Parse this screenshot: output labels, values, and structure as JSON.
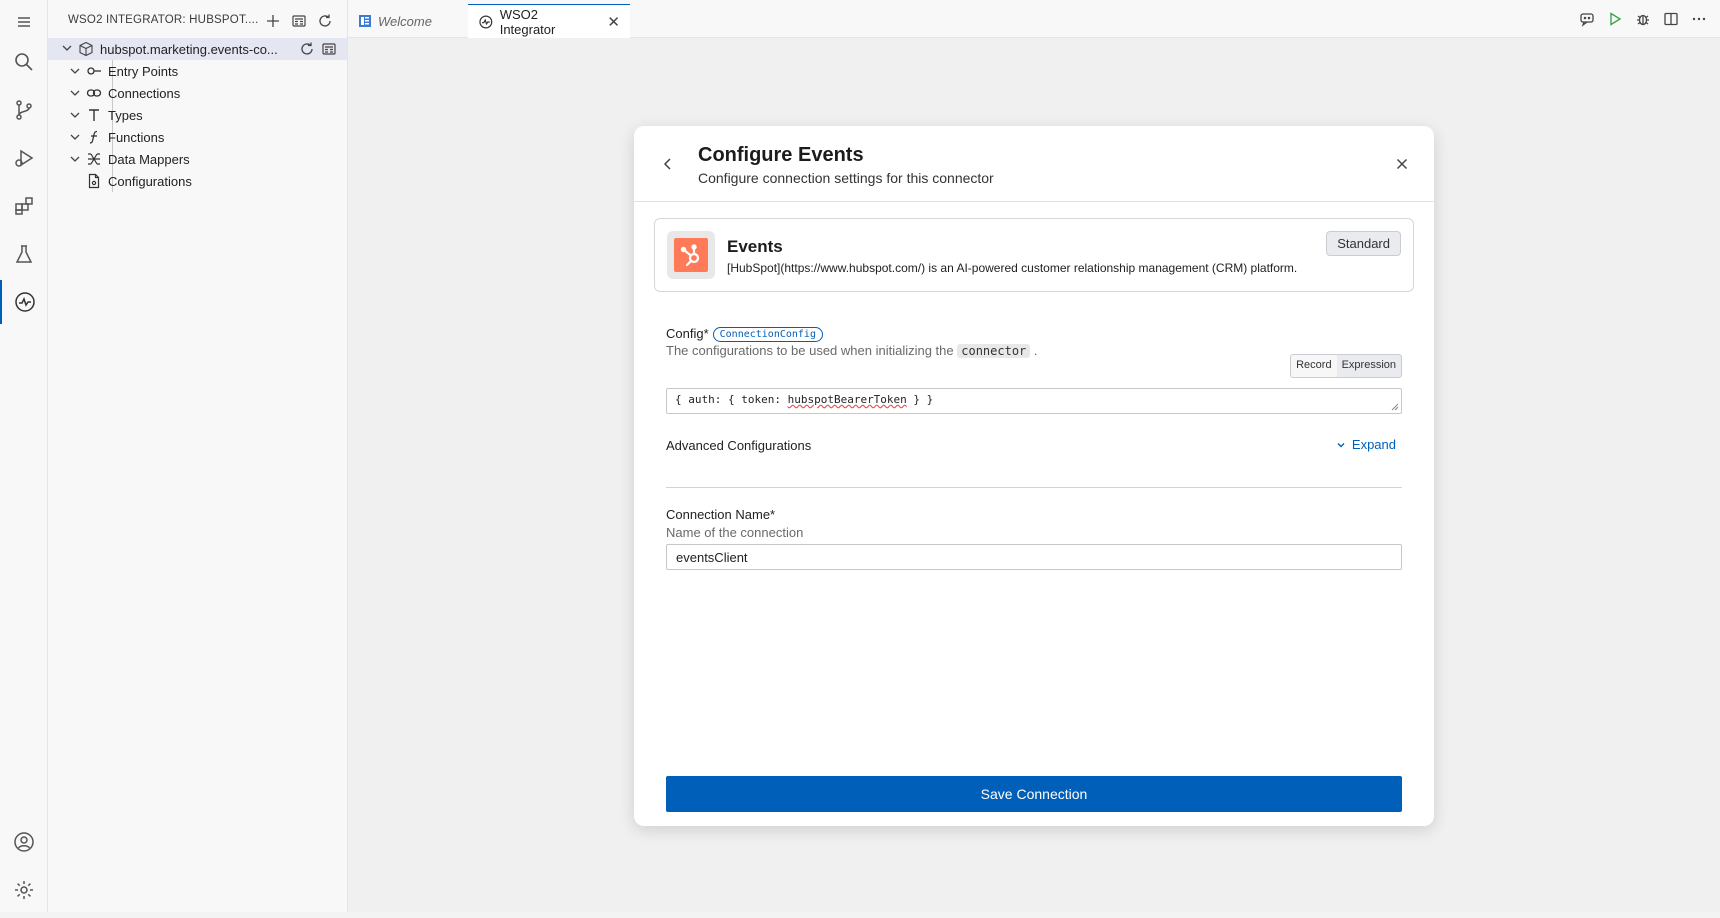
{
  "sidebar": {
    "title": "WSO2 INTEGRATOR: HUBSPOT....",
    "root": "hubspot.marketing.events-co...",
    "items": [
      {
        "label": "Entry Points",
        "icon": "entry-points-icon"
      },
      {
        "label": "Connections",
        "icon": "link-icon"
      },
      {
        "label": "Types",
        "icon": "type-icon"
      },
      {
        "label": "Functions",
        "icon": "function-icon"
      },
      {
        "label": "Data Mappers",
        "icon": "data-mapper-icon"
      },
      {
        "label": "Configurations",
        "icon": "config-file-icon"
      }
    ]
  },
  "tabs": {
    "welcome": "Welcome",
    "active": "WSO2 Integrator"
  },
  "modal": {
    "title": "Configure Events",
    "subtitle": "Configure connection settings for this connector",
    "connector": {
      "name": "Events",
      "description": "[HubSpot](https://www.hubspot.com/) is an AI-powered customer relationship management (CRM) platform.",
      "badge": "Standard",
      "brand_color": "#ff7a59"
    },
    "config": {
      "label": "Config*",
      "type_chip": "ConnectionConfig",
      "description_prefix": "The configurations to be used when initializing the",
      "description_code": "connector",
      "description_suffix": ".",
      "mode_record": "Record",
      "mode_expression": "Expression",
      "value_prefix": "{ auth: { token: ",
      "value_token": "hubspotBearerToken",
      "value_suffix": " } }"
    },
    "advanced": {
      "label": "Advanced Configurations",
      "toggle": "Expand"
    },
    "connection_name": {
      "label": "Connection Name*",
      "description": "Name of the connection",
      "value": "eventsClient"
    },
    "save_label": "Save Connection"
  },
  "colors": {
    "accent": "#005fb8"
  }
}
